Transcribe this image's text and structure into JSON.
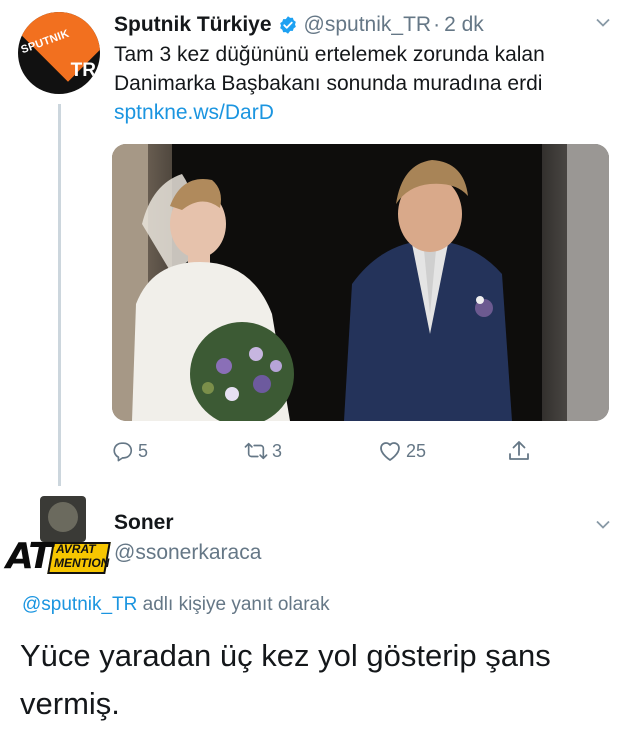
{
  "tweet": {
    "author": {
      "name": "Sputnik Türkiye",
      "handle": "@sputnik_TR",
      "avatar_logo_text": "SPUTNIK",
      "avatar_logo_sub": "TR",
      "verified": true
    },
    "separator": "·",
    "time": "2 dk",
    "text": "Tam 3 kez düğününü ertelemek zorunda kalan Danimarka Başbakanı sonunda muradına erdi",
    "link": "sptnkne.ws/DarD",
    "actions": {
      "replies": "5",
      "retweets": "3",
      "likes": "25"
    }
  },
  "reply": {
    "author": {
      "name": "Soner",
      "handle": "@ssonerkaraca",
      "sticker_main": "AT",
      "sticker_line1": "AVRAT",
      "sticker_line2": "MENTION"
    },
    "replying_to_mention": "@sputnik_TR",
    "replying_to_suffix": " adlı kişiye yanıt olarak",
    "text": "Yüce yaradan üç kez yol gösterip şans vermiş."
  },
  "colors": {
    "link": "#1b95e0",
    "muted": "#657786",
    "text": "#14171a",
    "thread_line": "#ccd6dd",
    "brand_orange": "#f2701f"
  },
  "icons": [
    "verified-badge-icon",
    "chevron-down-icon",
    "reply-icon",
    "retweet-icon",
    "like-icon",
    "share-icon"
  ]
}
